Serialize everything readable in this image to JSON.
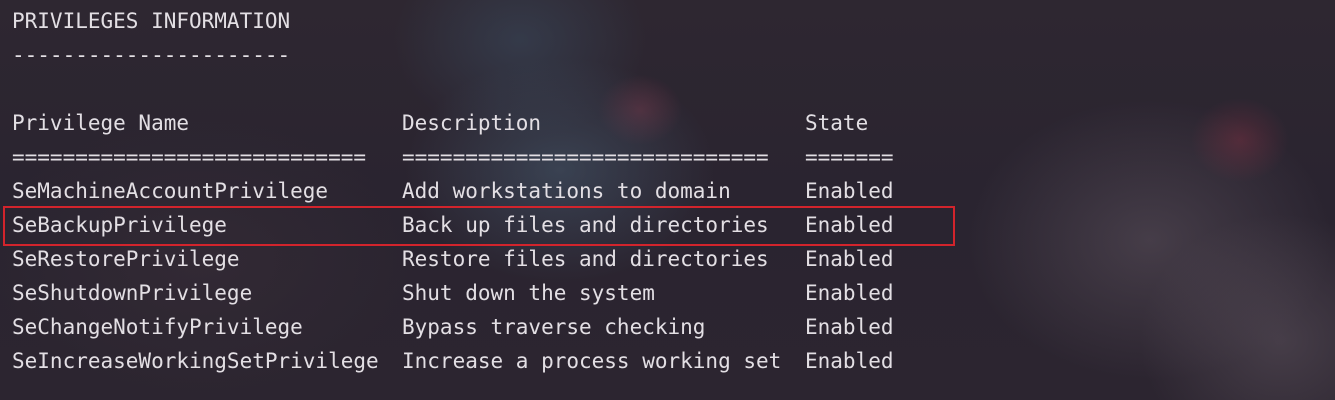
{
  "terminal": {
    "heading": "PRIVILEGES INFORMATION",
    "heading_rule": "----------------------",
    "columns": {
      "name": "Privilege Name",
      "description": "Description",
      "state": "State"
    },
    "separators": {
      "name": "============================",
      "description": "=============================",
      "state": "======="
    },
    "rows": [
      {
        "name": "SeMachineAccountPrivilege",
        "description": "Add workstations to domain",
        "state": "Enabled"
      },
      {
        "name": "SeBackupPrivilege",
        "description": "Back up files and directories",
        "state": "Enabled"
      },
      {
        "name": "SeRestorePrivilege",
        "description": "Restore files and directories",
        "state": "Enabled"
      },
      {
        "name": "SeShutdownPrivilege",
        "description": "Shut down the system",
        "state": "Enabled"
      },
      {
        "name": "SeChangeNotifyPrivilege",
        "description": "Bypass traverse checking",
        "state": "Enabled"
      },
      {
        "name": "SeIncreaseWorkingSetPrivilege",
        "description": "Increase a process working set",
        "state": "Enabled"
      }
    ]
  },
  "highlight": {
    "row_index": 1,
    "color": "#d2242c"
  },
  "colors": {
    "text": "#e3dfe4",
    "background": "#2b2530"
  }
}
